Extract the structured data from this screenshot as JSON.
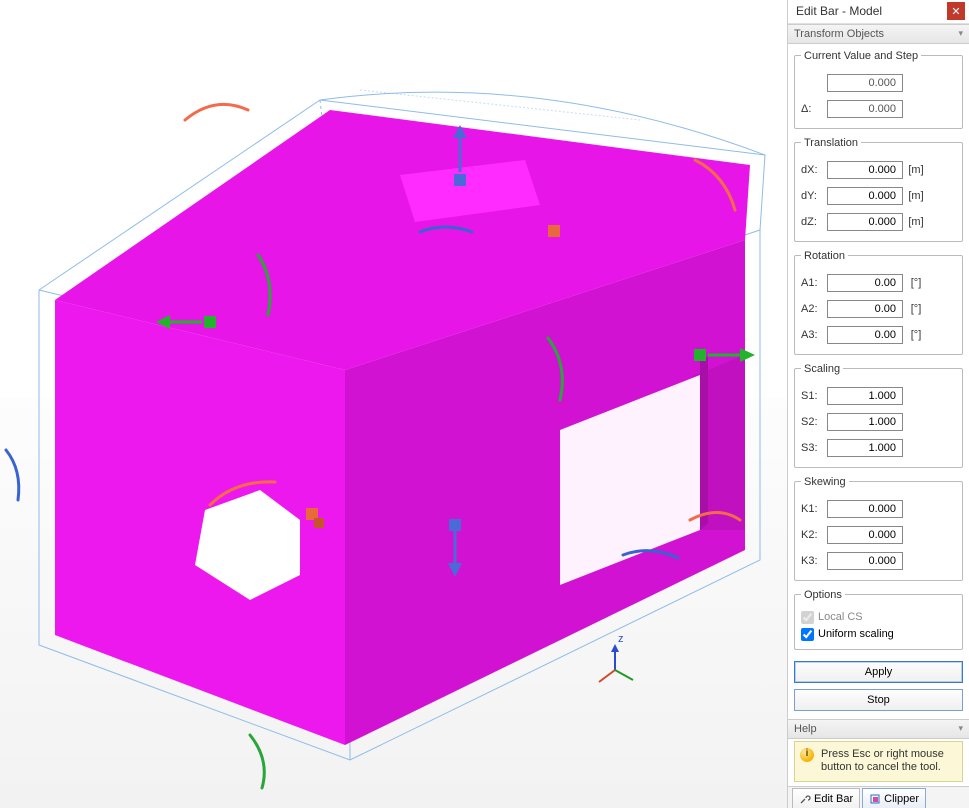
{
  "window": {
    "title": "Edit Bar - Model"
  },
  "sections": {
    "transform_header": "Transform Objects",
    "help_header": "Help"
  },
  "groups": {
    "current": "Current Value and Step",
    "translation": "Translation",
    "rotation": "Rotation",
    "scaling": "Scaling",
    "skewing": "Skewing",
    "options": "Options"
  },
  "labels": {
    "delta": "Δ:",
    "dX": "dX:",
    "dY": "dY:",
    "dZ": "dZ:",
    "A1": "A1:",
    "A2": "A2:",
    "A3": "A3:",
    "S1": "S1:",
    "S2": "S2:",
    "S3": "S3:",
    "K1": "K1:",
    "K2": "K2:",
    "K3": "K3:",
    "unit_m": "[m]",
    "unit_deg": "[°]"
  },
  "values": {
    "current": "0.000",
    "step": "0.000",
    "dX": "0.000",
    "dY": "0.000",
    "dZ": "0.000",
    "A1": "0.00",
    "A2": "0.00",
    "A3": "0.00",
    "S1": "1.000",
    "S2": "1.000",
    "S3": "1.000",
    "K1": "0.000",
    "K2": "0.000",
    "K3": "0.000"
  },
  "options": {
    "local_cs": "Local CS",
    "uniform_scaling": "Uniform scaling",
    "local_cs_checked": true,
    "local_cs_enabled": false,
    "uniform_scaling_checked": true
  },
  "buttons": {
    "apply": "Apply",
    "stop": "Stop"
  },
  "help": {
    "text": "Press Esc or right mouse button to cancel the tool."
  },
  "tabs": {
    "edit_bar": "Edit Bar",
    "clipper": "Clipper",
    "active": "clipper"
  },
  "scene": {
    "gizmo": {
      "labels": {
        "z": "z"
      }
    }
  }
}
